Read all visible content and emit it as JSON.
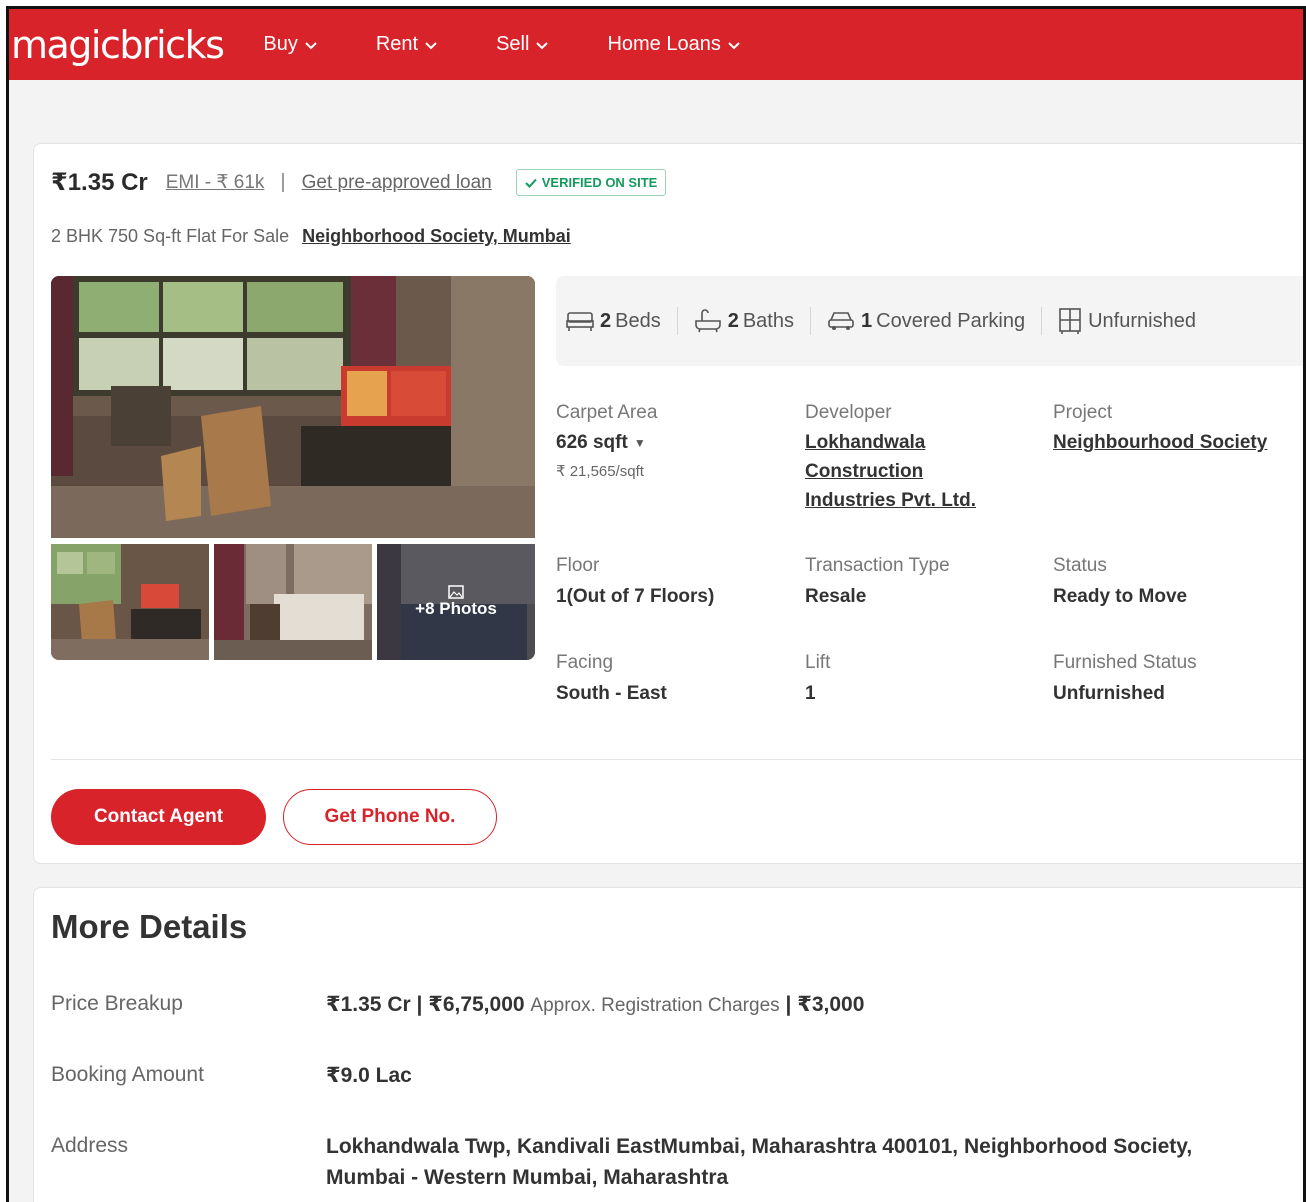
{
  "header": {
    "logo": "magicbricks",
    "nav": [
      {
        "label": "Buy"
      },
      {
        "label": "Rent"
      },
      {
        "label": "Sell"
      },
      {
        "label": "Home Loans"
      }
    ]
  },
  "listing": {
    "price": "₹1.35 Cr",
    "emi": "EMI - ₹ 61k",
    "separator": "|",
    "loan_link": "Get pre-approved loan",
    "verified_badge": "VERIFIED ON SITE",
    "subtitle": "2 BHK 750 Sq-ft Flat For Sale",
    "location": "Neighborhood Society, Mumbai",
    "more_photos": "+8 Photos",
    "amenities": {
      "beds_count": "2",
      "beds_label": "Beds",
      "baths_count": "2",
      "baths_label": "Baths",
      "parking_count": "1",
      "parking_label": "Covered Parking",
      "furnish_label": "Unfurnished"
    },
    "details": {
      "carpet_label": "Carpet Area",
      "carpet_value": "626 sqft",
      "carpet_rate": "₹ 21,565/sqft",
      "developer_label": "Developer",
      "developer_line1": "Lokhandwala",
      "developer_line2": "Construction",
      "developer_line3": "Industries Pvt. Ltd.",
      "project_label": "Project",
      "project_value": "Neighbourhood Society",
      "floor_label": "Floor",
      "floor_value": "1(Out of 7 Floors)",
      "transaction_label": "Transaction Type",
      "transaction_value": "Resale",
      "status_label": "Status",
      "status_value": "Ready to Move",
      "facing_label": "Facing",
      "facing_value": "South - East",
      "lift_label": "Lift",
      "lift_value": "1",
      "furnished_label": "Furnished Status",
      "furnished_value": "Unfurnished"
    },
    "contact_button": "Contact Agent",
    "phone_button": "Get Phone No."
  },
  "more_details": {
    "title": "More Details",
    "price_breakup_label": "Price Breakup",
    "price_breakup_value": "₹1.35 Cr | ₹6,75,000",
    "price_breakup_note": "Approx. Registration Charges",
    "price_breakup_extra": "| ₹3,000",
    "booking_label": "Booking Amount",
    "booking_value": "₹9.0 Lac",
    "address_label": "Address",
    "address_value": "Lokhandwala Twp, Kandivali EastMumbai, Maharashtra 400101, Neighborhood Society, Mumbai - Western Mumbai, Maharashtra"
  },
  "colors": {
    "brand_red": "#d8232a",
    "verified_green": "#139a5d"
  },
  "icons": [
    "chevron-down-icon",
    "check-icon",
    "bed-icon",
    "bath-icon",
    "car-icon",
    "wardrobe-icon",
    "gallery-icon",
    "more-options-icon"
  ]
}
